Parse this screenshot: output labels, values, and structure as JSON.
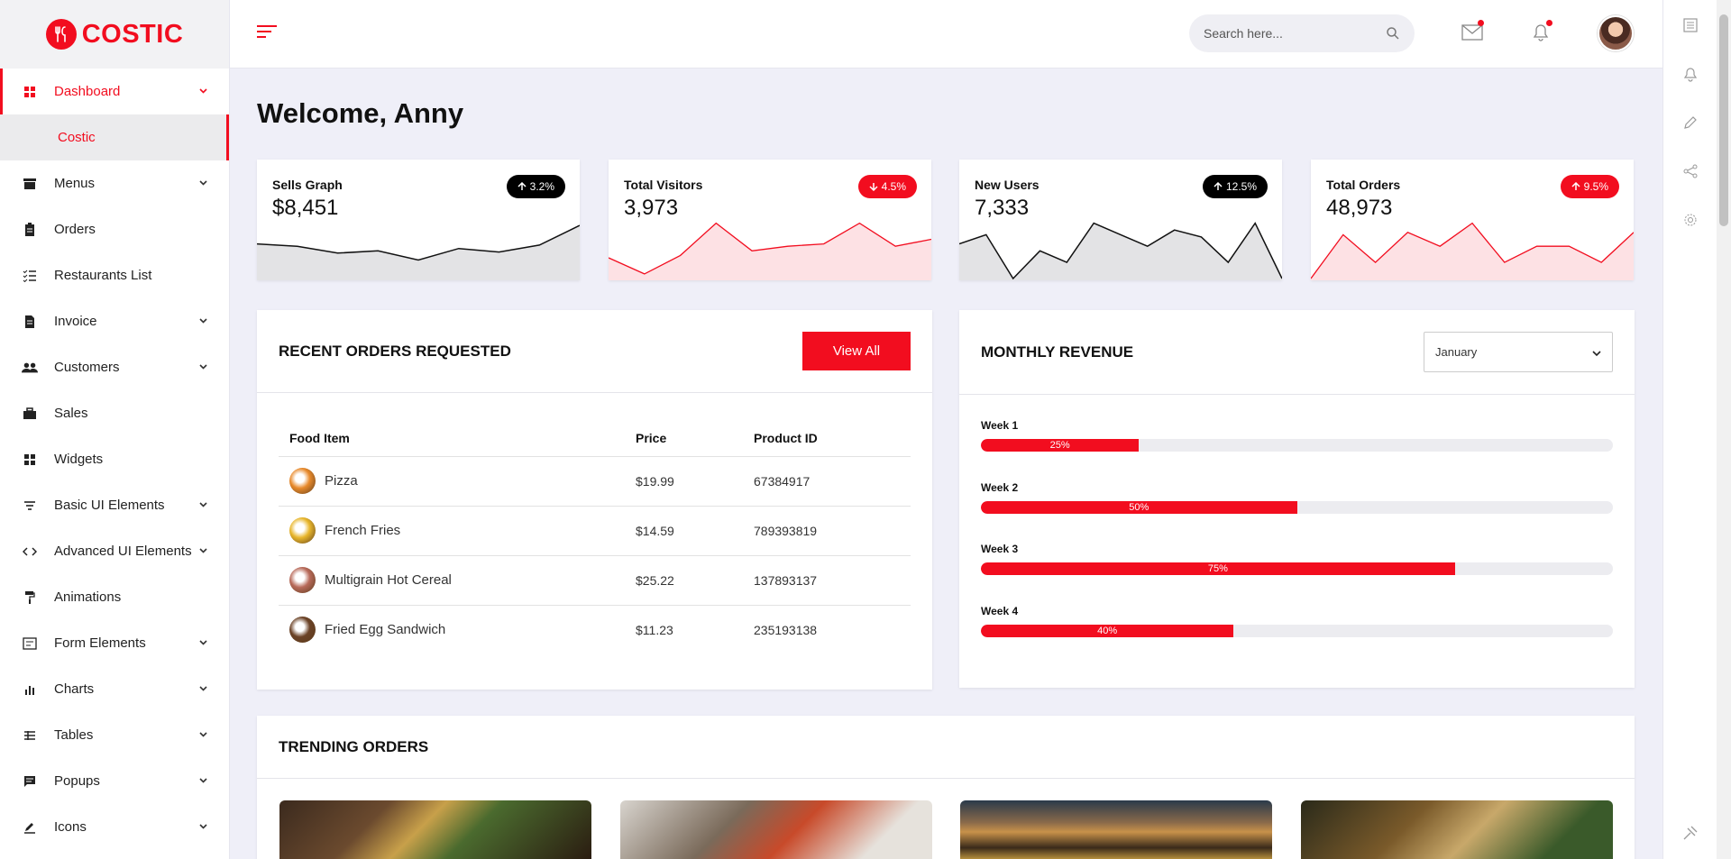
{
  "brand": {
    "name": "COSTIC"
  },
  "sidebar": {
    "items": [
      {
        "label": "Dashboard",
        "icon": "dashboard-icon",
        "active": true,
        "expandable": true
      },
      {
        "label": "Menus",
        "icon": "menu-box-icon",
        "expandable": true
      },
      {
        "label": "Orders",
        "icon": "clipboard-icon",
        "expandable": false
      },
      {
        "label": "Restaurants List",
        "icon": "list-check-icon",
        "expandable": false
      },
      {
        "label": "Invoice",
        "icon": "invoice-icon",
        "expandable": true
      },
      {
        "label": "Customers",
        "icon": "users-icon",
        "expandable": true
      },
      {
        "label": "Sales",
        "icon": "briefcase-icon",
        "expandable": false
      },
      {
        "label": "Widgets",
        "icon": "widgets-icon",
        "expandable": false
      },
      {
        "label": "Basic UI Elements",
        "icon": "filter-icon",
        "expandable": true
      },
      {
        "label": "Advanced UI Elements",
        "icon": "code-icon",
        "expandable": true
      },
      {
        "label": "Animations",
        "icon": "paint-roller-icon",
        "expandable": false
      },
      {
        "label": "Form Elements",
        "icon": "form-icon",
        "expandable": true
      },
      {
        "label": "Charts",
        "icon": "bar-chart-icon",
        "expandable": true
      },
      {
        "label": "Tables",
        "icon": "table-icon",
        "expandable": true
      },
      {
        "label": "Popups",
        "icon": "message-icon",
        "expandable": true
      },
      {
        "label": "Icons",
        "icon": "pen-icon",
        "expandable": true
      }
    ],
    "sub_item": "Costic"
  },
  "header": {
    "search_placeholder": "Search here..."
  },
  "page": {
    "welcome": "Welcome, Anny"
  },
  "stats": [
    {
      "title": "Sells Graph",
      "value": "$8,451",
      "change": "3.2%",
      "direction": "up",
      "pill_color": "#000000",
      "series": [
        30,
        28,
        22,
        24,
        16,
        26,
        23,
        29,
        46
      ]
    },
    {
      "title": "Total Visitors",
      "value": "3,973",
      "change": "4.5%",
      "direction": "down",
      "pill_color": "#f20d1f",
      "series": [
        18,
        4,
        20,
        48,
        24,
        28,
        30,
        48,
        28,
        34
      ]
    },
    {
      "title": "New Users",
      "value": "7,333",
      "change": "12.5%",
      "direction": "up",
      "pill_color": "#000000",
      "series": [
        30,
        38,
        0,
        24,
        14,
        48,
        38,
        28,
        42,
        36,
        14,
        48,
        0
      ]
    },
    {
      "title": "Total Orders",
      "value": "48,973",
      "change": "9.5%",
      "direction": "up",
      "pill_color": "#f20d1f",
      "series": [
        0,
        38,
        14,
        40,
        28,
        48,
        14,
        28,
        28,
        14,
        40
      ]
    }
  ],
  "recent_orders": {
    "title": "RECENT ORDERS REQUESTED",
    "view_all": "View All",
    "columns": [
      "Food Item",
      "Price",
      "Product ID"
    ],
    "rows": [
      {
        "item": "Pizza",
        "price": "$19.99",
        "id": "67384917",
        "thumb_color": "#e88a2c"
      },
      {
        "item": "French Fries",
        "price": "$14.59",
        "id": "789393819",
        "thumb_color": "#e8b62c"
      },
      {
        "item": "Multigrain Hot Cereal",
        "price": "$25.22",
        "id": "137893137",
        "thumb_color": "#b86a5a"
      },
      {
        "item": "Fried Egg Sandwich",
        "price": "$11.23",
        "id": "235193138",
        "thumb_color": "#6b4226"
      }
    ]
  },
  "monthly_revenue": {
    "title": "MONTHLY REVENUE",
    "selected_month": "January",
    "weeks": [
      {
        "label": "Week 1",
        "percent": 25,
        "text": "25%"
      },
      {
        "label": "Week 2",
        "percent": 50,
        "text": "50%"
      },
      {
        "label": "Week 3",
        "percent": 75,
        "text": "75%"
      },
      {
        "label": "Week 4",
        "percent": 40,
        "text": "40%"
      }
    ]
  },
  "trending": {
    "title": "TRENDING ORDERS"
  },
  "colors": {
    "accent": "#f20d1f",
    "dark": "#000000",
    "background": "#efeff8"
  }
}
